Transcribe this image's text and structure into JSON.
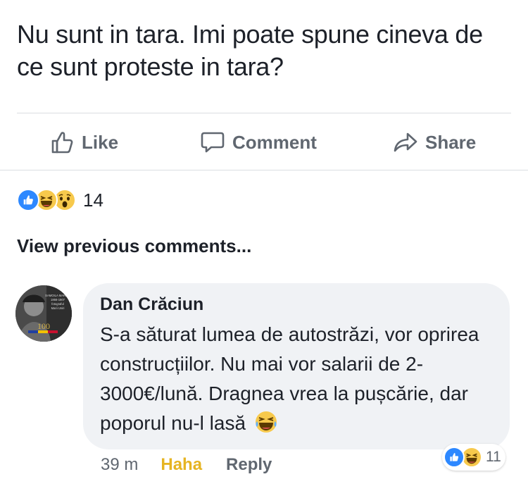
{
  "post": {
    "text": "Nu sunt in tara. Imi poate spune cineva de ce sunt proteste in tara?"
  },
  "actions": {
    "like_label": "Like",
    "comment_label": "Comment",
    "share_label": "Share"
  },
  "reactions": {
    "types": [
      "like-icon",
      "haha-icon",
      "wow-icon"
    ],
    "count": "14"
  },
  "comments": {
    "view_previous": "View previous comments..."
  },
  "comment": {
    "author": "Dan Crăciun",
    "text": "S-a săturat lumea de autostrăzi,  vor oprirea construcțiilor.  Nu mai vor salarii de 2-3000€/lună.  Dragnea vrea la pușcărie,  dar poporul nu-l lasă",
    "time": "39 m",
    "reaction_label": "Haha",
    "reply_label": "Reply",
    "reaction_count": "11",
    "avatar_text": [
      "SAMOILA MARE",
      "1866-1907",
      "fotograful",
      "Marii Uniri",
      "100"
    ]
  },
  "colors": {
    "like_blue": "#2d88ff",
    "haha_yellow": "#f7c94c",
    "haha_label": "#e6b422",
    "bubble_gray": "#f0f2f5",
    "text_dark": "#1d2129",
    "text_gray": "#606770"
  }
}
